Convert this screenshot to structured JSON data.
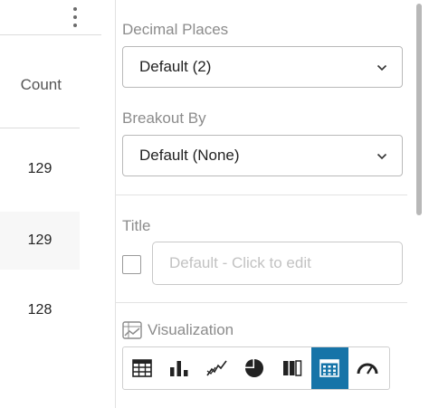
{
  "table": {
    "column_header": "Count",
    "rows": [
      "129",
      "129",
      "128"
    ]
  },
  "settings": {
    "decimal_places": {
      "label": "Decimal Places",
      "value": "Default (2)"
    },
    "breakout_by": {
      "label": "Breakout By",
      "value": "Default (None)"
    },
    "title": {
      "label": "Title",
      "placeholder": "Default - Click to edit",
      "checked": false
    },
    "visualization": {
      "label": "Visualization",
      "options": [
        "table",
        "bar",
        "line",
        "pie",
        "stacked-bar",
        "grid",
        "gauge"
      ],
      "active": "grid"
    }
  },
  "colors": {
    "accent": "#1674a8",
    "border": "#b9b9b9",
    "muted_text": "#8c8c8c"
  }
}
